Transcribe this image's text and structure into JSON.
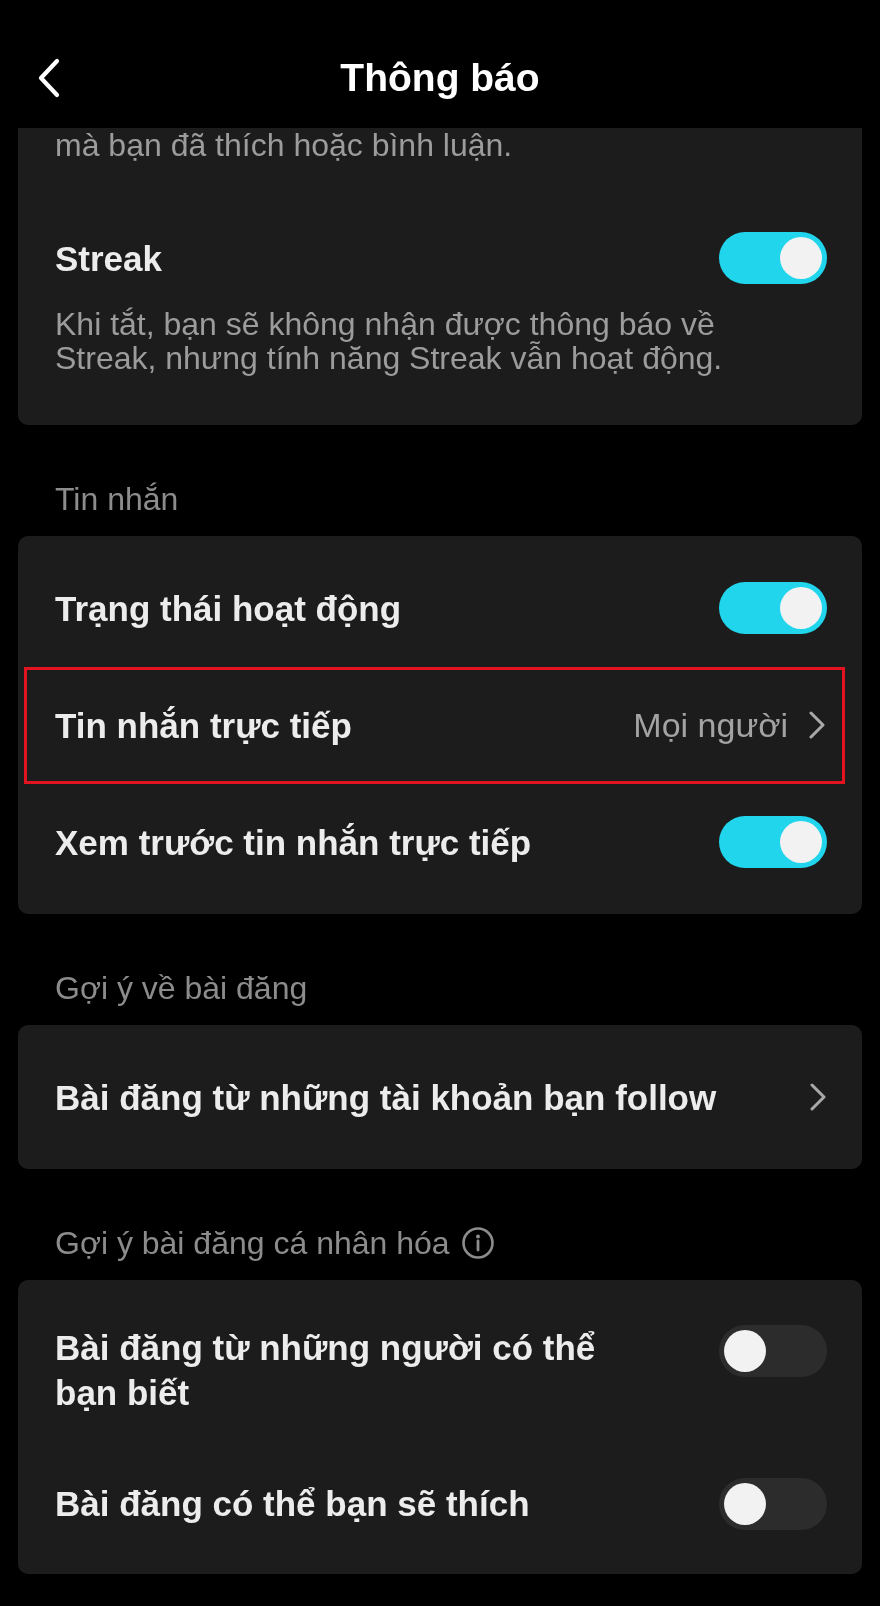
{
  "header": {
    "title": "Thông báo"
  },
  "sections": [
    {
      "items": [
        {
          "kind": "description",
          "text": "mà bạn đã thích hoặc bình luận."
        },
        {
          "kind": "toggle",
          "label": "Streak",
          "on": true,
          "description": "Khi tắt, bạn sẽ không nhận được thông báo về Streak, nhưng tính năng Streak vẫn hoạt động."
        }
      ]
    },
    {
      "heading": "Tin nhắn",
      "items": [
        {
          "kind": "toggle",
          "label": "Trạng thái hoạt động",
          "on": true,
          "highlighted": false
        },
        {
          "kind": "link",
          "label": "Tin nhắn trực tiếp",
          "value": "Mọi người",
          "highlighted": true
        },
        {
          "kind": "toggle",
          "label": "Xem trước tin nhắn trực tiếp",
          "on": true,
          "highlighted": false
        }
      ]
    },
    {
      "heading": "Gợi ý về bài đăng",
      "items": [
        {
          "kind": "link",
          "label": "Bài đăng từ những tài khoản bạn follow"
        }
      ]
    },
    {
      "heading": "Gợi ý bài đăng cá nhân hóa",
      "info": true,
      "items": [
        {
          "kind": "toggle",
          "label": "Bài đăng từ những người có thể bạn biết",
          "on": false
        },
        {
          "kind": "toggle",
          "label": "Bài đăng có thể bạn sẽ thích",
          "on": false
        }
      ]
    }
  ]
}
